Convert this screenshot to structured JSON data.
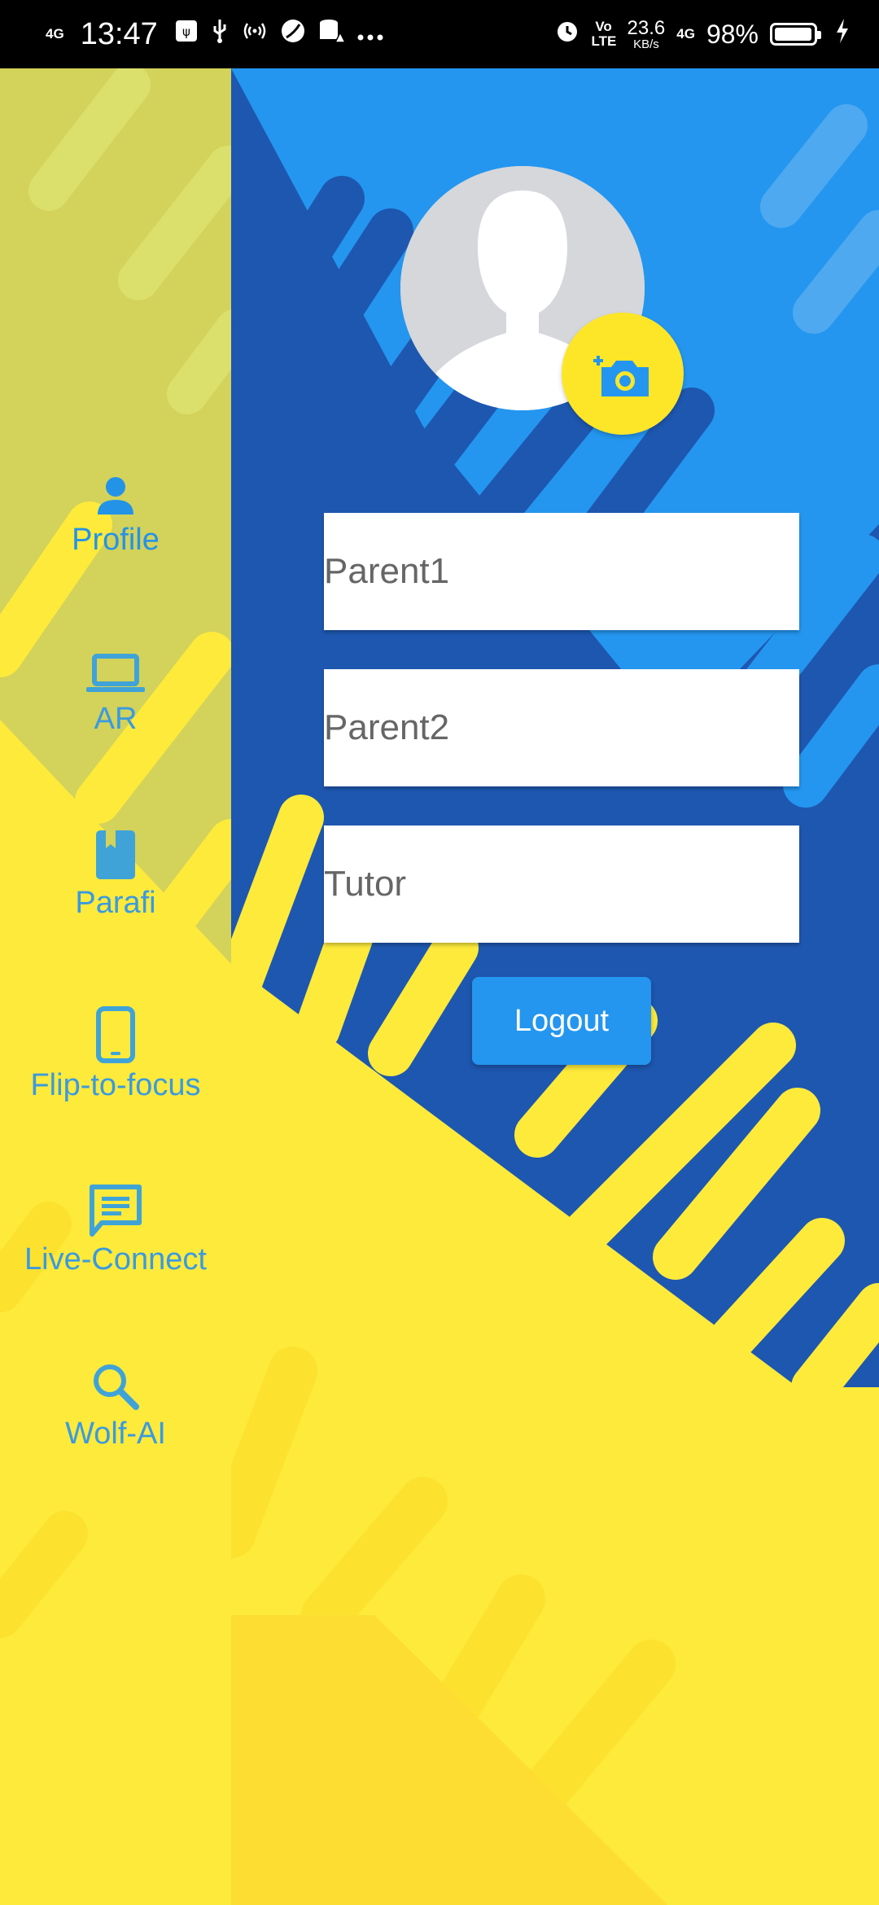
{
  "status_bar": {
    "network_left": "4G",
    "time": "13:47",
    "volte": "Vo LTE",
    "net_speed": "23.6",
    "net_unit": "KB/s",
    "network_right": "4G",
    "battery_percent": "98%",
    "battery_level": 0.98
  },
  "sidebar": {
    "items": [
      {
        "label": "Profile",
        "icon": "person-icon"
      },
      {
        "label": "AR",
        "icon": "laptop-icon"
      },
      {
        "label": "Parafi",
        "icon": "book-icon"
      },
      {
        "label": "Flip-to-focus",
        "icon": "phone-icon"
      },
      {
        "label": "Live-Connect",
        "icon": "chat-icon"
      },
      {
        "label": "Wolf-AI",
        "icon": "search-icon"
      }
    ]
  },
  "profile": {
    "parent1_placeholder": "Parent1",
    "parent2_placeholder": "Parent2",
    "tutor_placeholder": "Tutor",
    "logout_label": "Logout"
  },
  "colors": {
    "sidebar_icon": "#3fa3d8",
    "sidebar_active": "#2393e8",
    "yellow": "#fde93c",
    "blue_light": "#2496ef",
    "blue_dark": "#1e57b0",
    "sidebar_overlay": "#d2d35a"
  }
}
